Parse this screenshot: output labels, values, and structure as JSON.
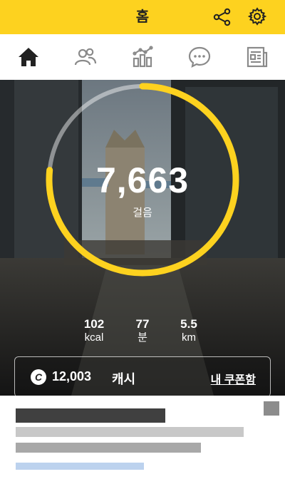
{
  "header": {
    "title": "홈",
    "share_icon": "share-icon",
    "settings_icon": "gear-icon",
    "accent_color": "#fdd21f"
  },
  "tabs": [
    {
      "icon": "home-icon",
      "active": true
    },
    {
      "icon": "friends-icon",
      "active": false
    },
    {
      "icon": "stats-icon",
      "active": false
    },
    {
      "icon": "chat-icon",
      "active": false
    },
    {
      "icon": "news-icon",
      "active": false
    }
  ],
  "steps": {
    "value": "7,663",
    "unit": "걸음",
    "goal_progress": 0.766
  },
  "stats": [
    {
      "value": "102",
      "unit": "kcal"
    },
    {
      "value": "77",
      "unit": "분"
    },
    {
      "value": "5.5",
      "unit": "km"
    }
  ],
  "cash": {
    "icon": "cash-coin-icon",
    "amount": "12,003",
    "unit": "캐시",
    "coupon_link": "내 쿠폰함"
  }
}
